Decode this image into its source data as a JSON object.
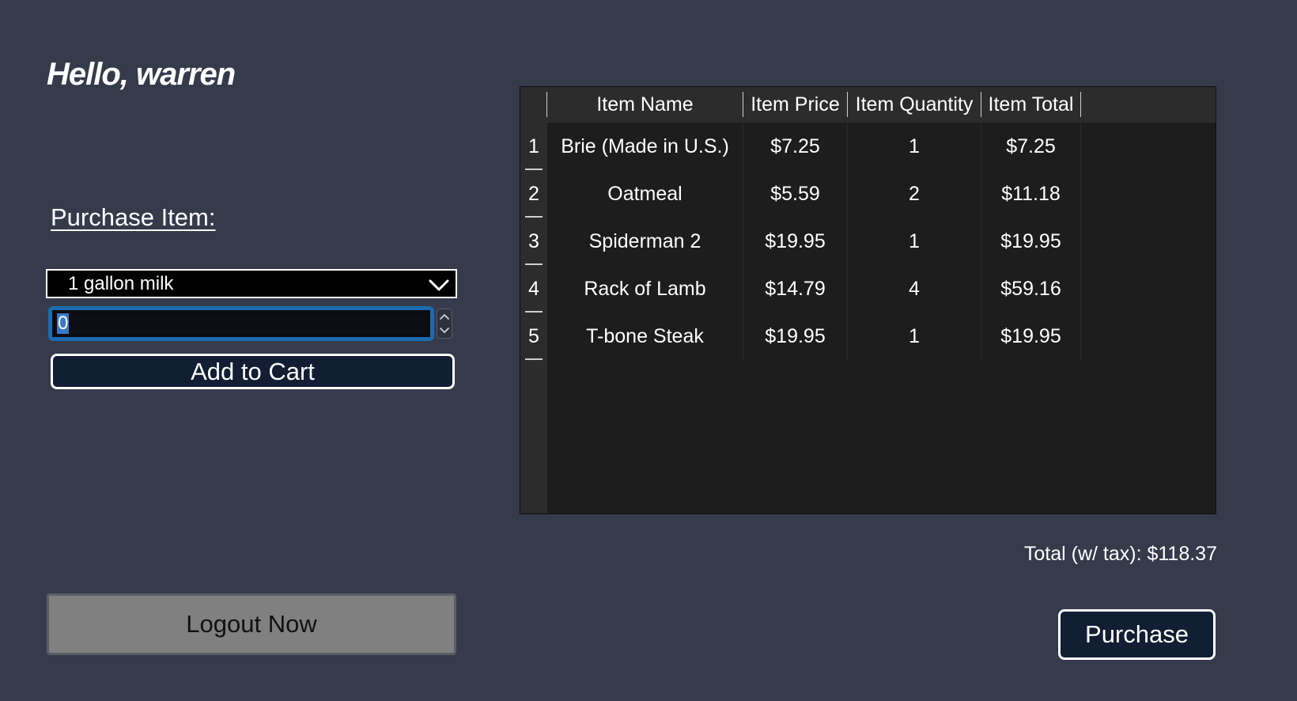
{
  "greeting": "Hello, warren",
  "purchase_section": {
    "label": "Purchase Item:",
    "selected_item": "1 gallon milk",
    "quantity_value": "0",
    "add_button": "Add to Cart"
  },
  "logout_button": "Logout Now",
  "cart_table": {
    "columns": [
      "Item Name",
      "Item Price",
      "Item Quantity",
      "Item Total"
    ],
    "rows": [
      {
        "num": "1",
        "name": "Brie (Made in U.S.)",
        "price": "$7.25",
        "qty": "1",
        "total": "$7.25"
      },
      {
        "num": "2",
        "name": "Oatmeal",
        "price": "$5.59",
        "qty": "2",
        "total": "$11.18"
      },
      {
        "num": "3",
        "name": "Spiderman 2",
        "price": "$19.95",
        "qty": "1",
        "total": "$19.95"
      },
      {
        "num": "4",
        "name": "Rack of Lamb",
        "price": "$14.79",
        "qty": "4",
        "total": "$59.16"
      },
      {
        "num": "5",
        "name": "T-bone Steak",
        "price": "$19.95",
        "qty": "1",
        "total": "$19.95"
      }
    ]
  },
  "total_text": "Total (w/ tax): $118.37",
  "purchase_button": "Purchase",
  "colors": {
    "background": "#353b4b",
    "button_fill": "#121e33",
    "focus_ring": "#1c6bb0",
    "logout_fill": "#808080",
    "table_bg": "#1d1d1d"
  }
}
